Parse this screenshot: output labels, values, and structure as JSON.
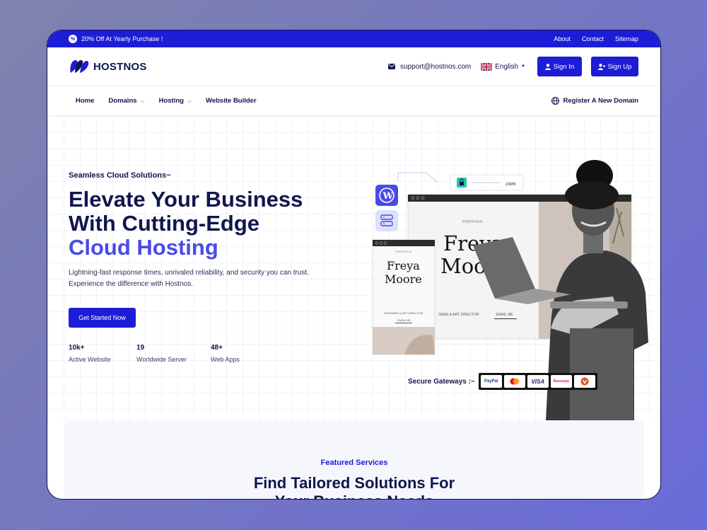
{
  "topbar": {
    "promo": "20% Off At Yearly Purchase !",
    "links": [
      "About",
      "Contact",
      "Sitemap"
    ]
  },
  "header": {
    "logo": "HOSTNOS",
    "email": "support@hostnos.com",
    "language": "English",
    "signin": "Sign In",
    "signup": "Sign Up"
  },
  "nav": {
    "items": [
      "Home",
      "Domains",
      "Hosting",
      "Website Builder"
    ],
    "register": "Register A New Domain"
  },
  "hero": {
    "tagline": "Seamless Cloud Solutions~",
    "title_line1": "Elevate Your Business",
    "title_line2": "With Cutting-Edge",
    "title_accent": "Cloud Hosting",
    "description_line1": "Lightning-fast response times, unrivaled reliability, and security you can trust.",
    "description_line2": "Experience the difference with Hostnos.",
    "cta": "Get Started Now",
    "stats": [
      {
        "value": "10k+",
        "label": "Active Website"
      },
      {
        "value": "19",
        "label": "Worldwide Server"
      },
      {
        "value": "48+",
        "label": "Web Apps"
      }
    ]
  },
  "illustration": {
    "domain_suffix": ".com",
    "portfolio_label": "PORTFOLIO",
    "name_first": "Freya",
    "name_last": "Moore",
    "designer_small": "DESIGNER & ART DIRECTOR",
    "designer_big": "GNER & ART DIRECTOR",
    "email_me": "EMAIL ME",
    "big_first": "Freya",
    "big_last": "Moo"
  },
  "gateways": {
    "label": "Secure Gateways :~",
    "cards": [
      "PayPal",
      "Mastercard",
      "VISA",
      "Razorpay",
      "UPI"
    ]
  },
  "featured": {
    "tag": "Featured Services",
    "title_line1": "Find Tailored Solutions For",
    "title_line2": "Your Business Needs"
  },
  "colors": {
    "primary": "#1d1dd6",
    "navy": "#10164d",
    "accent": "#4a4ae8"
  }
}
